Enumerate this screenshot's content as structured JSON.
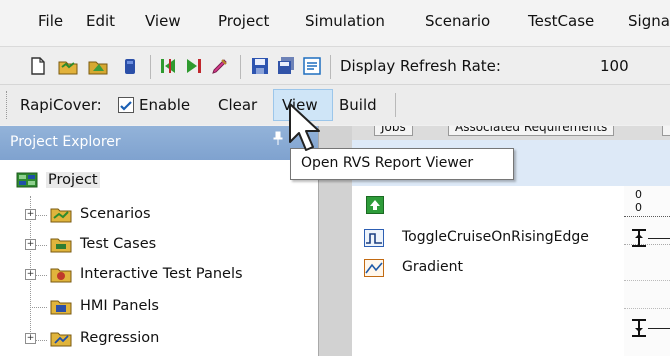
{
  "menu": {
    "items": [
      "File",
      "Edit",
      "View",
      "Project",
      "Simulation",
      "Scenario",
      "TestCase",
      "Signa"
    ]
  },
  "toolbar": {
    "display_refresh_label": "Display Refresh Rate:",
    "display_refresh_value": "100"
  },
  "rapicover": {
    "label": "RapiCover:",
    "enable_label": "Enable",
    "enable_checked": true,
    "clear_label": "Clear",
    "view_label": "View",
    "build_label": "Build"
  },
  "tooltip": {
    "text": "Open RVS Report Viewer"
  },
  "explorer": {
    "title": "Project Explorer",
    "root": "Project",
    "items": [
      "Scenarios",
      "Test Cases",
      "Interactive Test Panels",
      "HMI Panels",
      "Regression"
    ]
  },
  "tabs": [
    "Jobs",
    "Associated Requirements"
  ],
  "timeline": {
    "scale_top": "0",
    "scale_bottom": "0"
  },
  "grid": {
    "rows": [
      "ToggleCruiseOnRisingEdge",
      "Gradient"
    ]
  },
  "colors": {
    "explorer_header": "#7fa2cf",
    "view_button_highlight": "#cfe5f7",
    "content_header": "#dde9f7"
  }
}
